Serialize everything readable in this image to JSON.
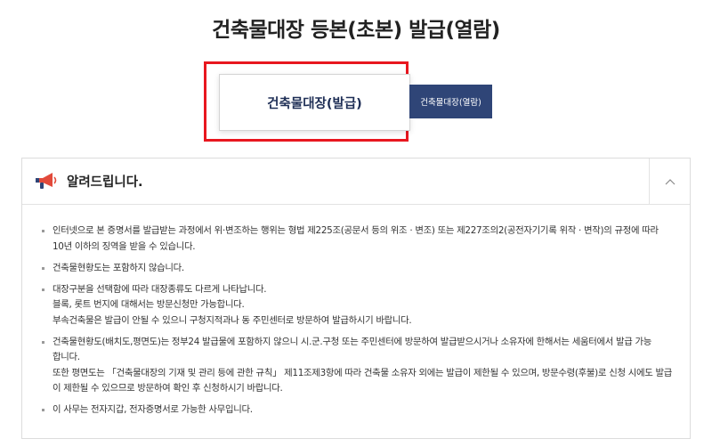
{
  "page": {
    "title": "건축물대장 등본(초본) 발급(열람)"
  },
  "tabs": {
    "issue_label": "건축물대장(발급)",
    "view_label": "건축물대장(열람)"
  },
  "notice": {
    "title": "알려드립니다.",
    "items": [
      {
        "lines": [
          "인터넷으로 본 증명서를 발급받는 과정에서 위·변조하는 행위는 형법 제225조(공문서 등의 위조 · 변조) 또는 제227조의2(공전자기기록 위작 · 변작)의 규정에 따라",
          "10년 이하의 징역을 받을 수 있습니다."
        ]
      },
      {
        "lines": [
          "건축물현황도는 포함하지 않습니다."
        ]
      },
      {
        "lines": [
          "대장구분을 선택함에 따라 대장종류도 다르게 나타납니다.",
          "블록, 롯트 번지에 대해서는 방문신청만 가능합니다.",
          "부속건축물은 발급이 안될 수 있으니 구청지적과나 동 주민센터로 방문하여 발급하시기 바랍니다."
        ]
      },
      {
        "lines": [
          "건축물현황도(배치도,평면도)는 정부24 발급물에 포함하지 않으니 시.군.구청 또는 주민센터에 방문하여 발급받으시거나 소유자에 한해서는 세움터에서 발급 가능",
          "합니다.",
          "또한 평면도는 「건축물대장의 기재 및 관리 등에 관한 규칙」 제11조제3항에 따라 건축물 소유자 외에는 발급이 제한될 수 있으며, 방문수령(후불)로 신청 시에도 발급",
          "이 제한될 수 있으므로 방문하여 확인 후 신청하시기 바랍니다."
        ]
      },
      {
        "lines": [
          "이 사무는 전자지갑, 전자증명서로 가능한 사무입니다."
        ]
      }
    ]
  },
  "colors": {
    "highlight": "#e8171f",
    "tab_active_text": "#1f2f56",
    "tab_view_bg": "#2f4577",
    "megaphone": "#e24a3b"
  },
  "icons": {
    "notice_icon": "megaphone-icon",
    "toggle_icon": "chevron-up-icon"
  }
}
